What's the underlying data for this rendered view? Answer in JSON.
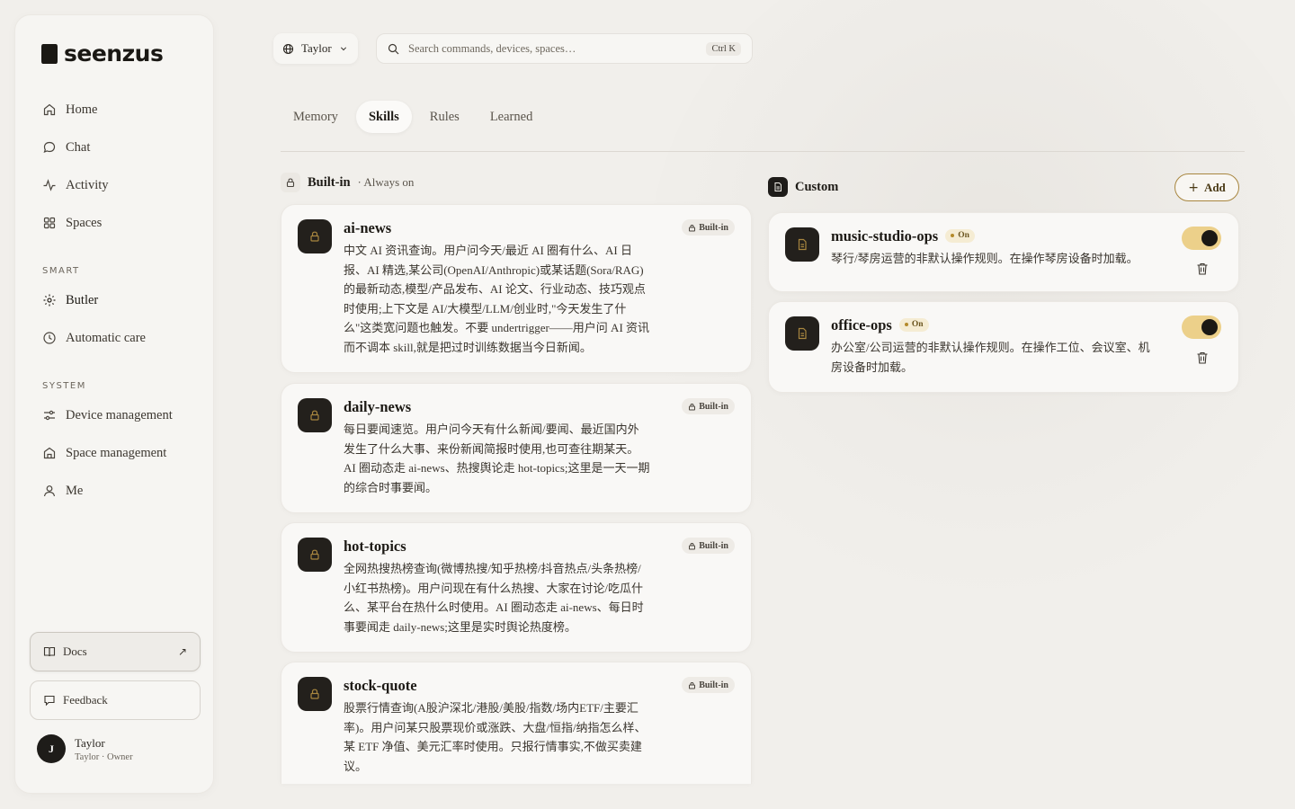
{
  "app": {
    "brand": "seenzus",
    "colors": {
      "accent": "#ecd08a",
      "accent_border": "#a8863f",
      "dark": "#1e1c19",
      "background": "#f1efeb"
    }
  },
  "sidebar": {
    "nav": [
      {
        "label": "Home",
        "icon": "home-icon"
      },
      {
        "label": "Chat",
        "icon": "chat-icon"
      },
      {
        "label": "Activity",
        "icon": "activity-icon"
      },
      {
        "label": "Spaces",
        "icon": "grid-icon"
      }
    ],
    "smart_label": "SMART",
    "smart": [
      {
        "label": "Butler",
        "icon": "sparkle-icon"
      },
      {
        "label": "Automatic care",
        "icon": "clock-icon"
      }
    ],
    "system_label": "SYSTEM",
    "system": [
      {
        "label": "Device management",
        "icon": "sliders-icon"
      },
      {
        "label": "Space management",
        "icon": "building-icon"
      },
      {
        "label": "Me",
        "icon": "user-icon"
      }
    ],
    "docs_label": "Docs",
    "docs_arrow": "↗",
    "feedback_label": "Feedback",
    "user": {
      "initial": "J",
      "name": "Taylor",
      "role": "Taylor · Owner"
    }
  },
  "topbar": {
    "user_selector": "Taylor",
    "search_placeholder": "Search commands, devices, spaces…",
    "shortcut": "Ctrl K"
  },
  "tabs": [
    {
      "label": "Memory",
      "active": false
    },
    {
      "label": "Skills",
      "active": true
    },
    {
      "label": "Rules",
      "active": false
    },
    {
      "label": "Learned",
      "active": false
    }
  ],
  "builtin": {
    "title": "Built-in",
    "subtitle": "· Always on",
    "badge": "Built-in",
    "skills": [
      {
        "name": "ai-news",
        "lines": [
          "中文 AI 资讯查询。用户问今天/最近 AI 圈有什么、AI 日",
          "报、AI 精选,某公司(OpenAI/Anthropic)或某话题(Sora/RAG)",
          "的最新动态,模型/产品发布、AI 论文、行业动态、技巧观点",
          "时使用;上下文是 AI/大模型/LLM/创业时,\"今天发生了什",
          "么\"这类宽问题也触发。不要 undertrigger——用户问 AI 资讯",
          "而不调本 skill,就是把过时训练数据当今日新闻。"
        ]
      },
      {
        "name": "daily-news",
        "lines": [
          "每日要闻速览。用户问今天有什么新闻/要闻、最近国内外",
          "发生了什么大事、来份新闻简报时使用,也可查往期某天。",
          "AI 圈动态走 ai-news、热搜舆论走 hot-topics;这里是一天一期",
          "的综合时事要闻。"
        ]
      },
      {
        "name": "hot-topics",
        "lines": [
          "全网热搜热榜查询(微博热搜/知乎热榜/抖音热点/头条热榜/",
          "小红书热榜)。用户问现在有什么热搜、大家在讨论/吃瓜什",
          "么、某平台在热什么时使用。AI 圈动态走 ai-news、每日时",
          "事要闻走 daily-news;这里是实时舆论热度榜。"
        ]
      },
      {
        "name": "stock-quote",
        "lines": [
          "股票行情查询(A股沪深北/港股/美股/指数/场内ETF/主要汇",
          "率)。用户问某只股票现价或涨跌、大盘/恒指/纳指怎么样、",
          "某 ETF 净值、美元汇率时使用。只报行情事实,不做买卖建",
          "议。"
        ]
      }
    ]
  },
  "custom": {
    "title": "Custom",
    "add_label": "Add",
    "on_label": "On",
    "skills": [
      {
        "name": "music-studio-ops",
        "enabled": true,
        "lines": [
          "琴行/琴房运营的非默认操作规则。在操作琴房设备时加载。"
        ]
      },
      {
        "name": "office-ops",
        "enabled": true,
        "lines": [
          "办公室/公司运营的非默认操作规则。在操作工位、会议室、机",
          "房设备时加载。"
        ]
      }
    ]
  }
}
